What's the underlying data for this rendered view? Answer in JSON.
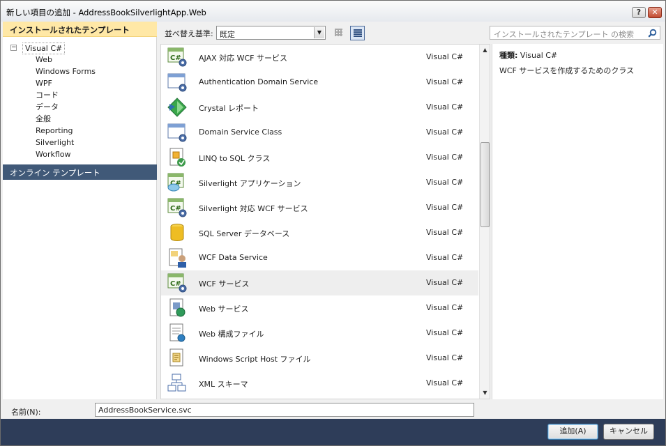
{
  "window": {
    "title": "新しい項目の追加 - AddressBookSilverlightApp.Web",
    "help_glyph": "?",
    "close_glyph": "✕"
  },
  "left_pane": {
    "installed_header": "インストールされたテンプレート",
    "expander_glyph": "−",
    "tree_root": "Visual C#",
    "tree_children": [
      "Web",
      "Windows Forms",
      "WPF",
      "コード",
      "データ",
      "全般",
      "Reporting",
      "Silverlight",
      "Workflow"
    ],
    "online_header": "オンライン テンプレート"
  },
  "toolbar": {
    "sort_label": "並べ替え基準:",
    "sort_value": "既定",
    "search_placeholder": "インストールされたテンプレート の検索"
  },
  "templates": [
    {
      "name": "AJAX 対応 WCF サービス",
      "language": "Visual C#",
      "icon": "wcf-service-icon"
    },
    {
      "name": "Authentication Domain Service",
      "language": "Visual C#",
      "icon": "domain-service-icon"
    },
    {
      "name": "Crystal レポート",
      "language": "Visual C#",
      "icon": "crystal-report-icon"
    },
    {
      "name": "Domain Service Class",
      "language": "Visual C#",
      "icon": "domain-service-icon"
    },
    {
      "name": "LINQ to SQL クラス",
      "language": "Visual C#",
      "icon": "linq-to-sql-icon"
    },
    {
      "name": "Silverlight アプリケーション",
      "language": "Visual C#",
      "icon": "silverlight-app-icon"
    },
    {
      "name": "Silverlight 対応 WCF サービス",
      "language": "Visual C#",
      "icon": "wcf-service-icon"
    },
    {
      "name": "SQL Server データベース",
      "language": "Visual C#",
      "icon": "database-icon"
    },
    {
      "name": "WCF Data Service",
      "language": "Visual C#",
      "icon": "data-service-icon"
    },
    {
      "name": "WCF サービス",
      "language": "Visual C#",
      "icon": "wcf-service-icon"
    },
    {
      "name": "Web サービス",
      "language": "Visual C#",
      "icon": "web-service-icon"
    },
    {
      "name": "Web 構成ファイル",
      "language": "Visual C#",
      "icon": "web-config-icon"
    },
    {
      "name": "Windows Script Host ファイル",
      "language": "Visual C#",
      "icon": "script-file-icon"
    },
    {
      "name": "XML スキーマ",
      "language": "Visual C#",
      "icon": "xml-schema-icon"
    }
  ],
  "selected_index": 9,
  "detail": {
    "type_label": "種類:",
    "type_value": "Visual C#",
    "description": "WCF サービスを作成するためのクラス"
  },
  "footer": {
    "name_label": "名前(N):",
    "name_value": "AddressBookService.svc",
    "add_label": "追加(A)",
    "cancel_label": "キャンセル"
  },
  "colors": {
    "installed_header_bg": "#ffe8a6",
    "online_header_bg": "#405978",
    "footer_bg": "#2e3d59",
    "selected_row_bg": "#eeeeee"
  }
}
